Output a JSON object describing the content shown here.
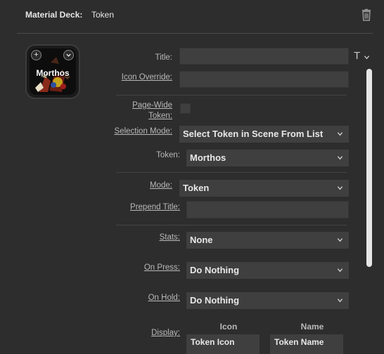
{
  "header": {
    "label": "Material Deck:",
    "value": "Token",
    "delete_icon": "trash-icon"
  },
  "tile": {
    "text": "Morthos",
    "add_icon": "plus-icon",
    "menu_icon": "chevron-down-icon"
  },
  "form": {
    "title_label": "Title:",
    "title_value": "",
    "title_format_glyph": "T",
    "icon_override_label": "Icon Override:",
    "icon_override_value": "",
    "page_wide_label_1": "Page-Wide",
    "page_wide_label_2": "Token:",
    "page_wide_checked": false,
    "selection_mode_label": "Selection Mode:",
    "selection_mode_value": "Select Token in Scene From List",
    "token_label": "Token:",
    "token_value": "Morthos",
    "mode_label": "Mode:",
    "mode_value": "Token",
    "prepend_title_label": "Prepend Title:",
    "prepend_title_value": "",
    "stats_label": "Stats:",
    "stats_value": "None",
    "on_press_label": "On Press:",
    "on_press_value": "Do Nothing",
    "on_hold_label": "On Hold:",
    "on_hold_value": "Do Nothing",
    "display_label": "Display:",
    "display_col_icon": "Icon",
    "display_col_name": "Name",
    "display_icon_value": "Token Icon",
    "display_name_value": "Token Name"
  }
}
